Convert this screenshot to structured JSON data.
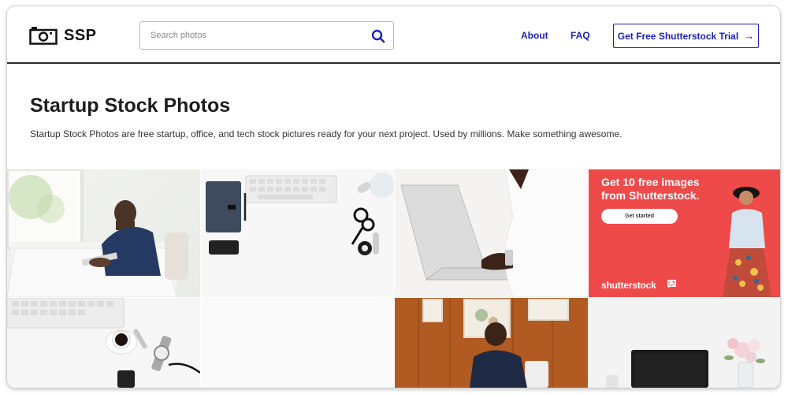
{
  "header": {
    "logo_text": "SSP",
    "search": {
      "placeholder": "Search photos",
      "value": ""
    },
    "nav": {
      "about": "About",
      "faq": "FAQ"
    },
    "cta_label": "Get Free Shutterstock Trial",
    "cta_arrow": "→"
  },
  "hero": {
    "title": "Startup Stock Photos",
    "description": "Startup Stock Photos are free startup, office, and tech stock pictures ready for your next project. Used by millions. Make something awesome."
  },
  "ad": {
    "headline": "Get 10 free images from Shutterstock.",
    "button": "Get started",
    "brand": "shutterstock"
  },
  "colors": {
    "accent": "#1a22b8",
    "ad_background": "#ee4a49",
    "header_border": "#2b2b2b"
  },
  "icons": [
    "camera-icon",
    "search-icon",
    "arrow-right-icon",
    "photo-icon",
    "music-icon",
    "video-icon"
  ]
}
